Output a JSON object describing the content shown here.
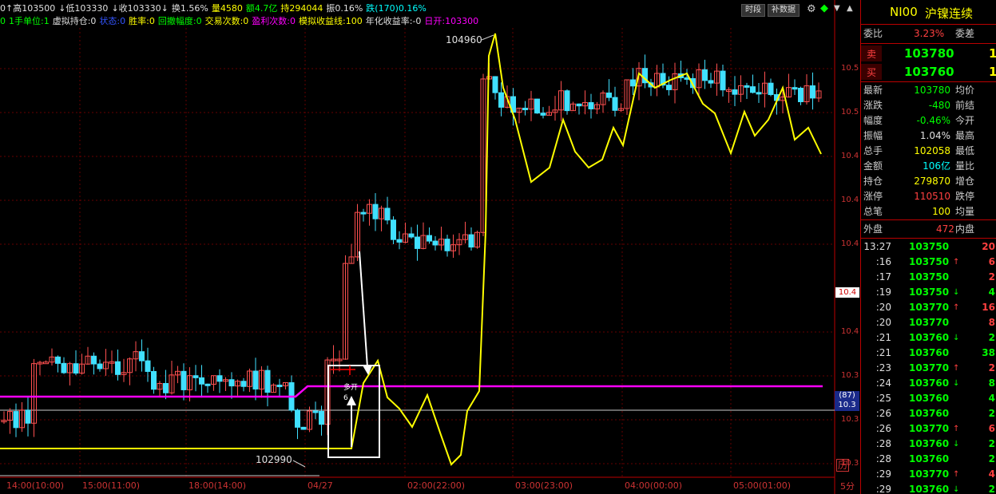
{
  "header": {
    "line1": [
      {
        "text": "0↑高103500",
        "color": "#e0e0e0"
      },
      {
        "text": "↓低103330",
        "color": "#e0e0e0"
      },
      {
        "text": "↓收103330↓",
        "color": "#e0e0e0"
      },
      {
        "text": "换1.56%",
        "color": "#e0e0e0"
      },
      {
        "text": "量4580",
        "color": "#ffff00"
      },
      {
        "text": "额4.7亿",
        "color": "#00ff00"
      },
      {
        "text": "持294044",
        "color": "#ffff00"
      },
      {
        "text": "振0.16%",
        "color": "#e0e0e0"
      },
      {
        "text": "跌(170)0.16%",
        "color": "#00ffff"
      }
    ],
    "line2": [
      {
        "text": "0",
        "color": "#00ff00"
      },
      {
        "text": "1手单位:1",
        "color": "#00ff00"
      },
      {
        "text": "虚拟持仓:0",
        "color": "#e0e0e0"
      },
      {
        "text": "状态:0",
        "color": "#3355ff"
      },
      {
        "text": "胜率:0",
        "color": "#ffff00"
      },
      {
        "text": "回撤幅度:0",
        "color": "#00ff00"
      },
      {
        "text": "交易次数:0",
        "color": "#ffff00"
      },
      {
        "text": "盈利次数:0",
        "color": "#ff00ff"
      },
      {
        "text": "模拟收益线:100",
        "color": "#ffff00"
      },
      {
        "text": "年化收益率:-0",
        "color": "#e0e0e0"
      },
      {
        "text": "日开:103300",
        "color": "#ff00ff"
      }
    ]
  },
  "top_buttons": {
    "timeshare": "时段",
    "refill": "补数据"
  },
  "annotations": {
    "high": "104960",
    "low": "102990",
    "open_long": "多开",
    "arrow_num": "6"
  },
  "x_axis": [
    "14:00(10:00)",
    "15:00(11:00)",
    "18:00(14:00)",
    "04/27",
    "02:00(22:00)",
    "03:00(23:00)",
    "04:00(00:00)",
    "05:00(01:00)"
  ],
  "y_axis": {
    "labels": [
      "10.5",
      "10.5",
      "10.4",
      "10.4",
      "10.4",
      "10.4",
      "10.3",
      "10.3",
      "10.3"
    ],
    "current": "10.4",
    "badge_top": "(87)",
    "badge_bottom": "10.3",
    "period": "5分",
    "corner_icon": "历"
  },
  "quote": {
    "title_code": "NI00",
    "title_name": "沪镍连续",
    "weibi_label": "委比",
    "weibi_value": "3.23%",
    "weicha_label": "委差",
    "sell_label": "卖",
    "sell_price": "103780",
    "buy_label": "买",
    "buy_price": "103760",
    "stats": [
      {
        "l1": "最新",
        "v1": "103780",
        "c1": "#00ff00",
        "l2": "均价"
      },
      {
        "l1": "涨跌",
        "v1": "-480",
        "c1": "#00ff00",
        "l2": "前结"
      },
      {
        "l1": "幅度",
        "v1": "-0.46%",
        "c1": "#00ff00",
        "l2": "今开"
      },
      {
        "l1": "振幅",
        "v1": "1.04%",
        "c1": "#e0e0e0",
        "l2": "最高"
      },
      {
        "l1": "总手",
        "v1": "102058",
        "c1": "#ffff00",
        "l2": "最低"
      },
      {
        "l1": "金额",
        "v1": "106亿",
        "c1": "#00ffff",
        "l2": "量比"
      },
      {
        "l1": "持仓",
        "v1": "279870",
        "c1": "#ffff00",
        "l2": "增仓"
      },
      {
        "l1": "涨停",
        "v1": "110510",
        "c1": "#ff4040",
        "l2": "跌停"
      },
      {
        "l1": "总笔",
        "v1": "100",
        "c1": "#ffff00",
        "l2": "均量"
      }
    ],
    "outer_label": "外盘",
    "outer_value": "472",
    "inner_label": "内盘",
    "ticks": [
      {
        "t": "13:27",
        "p": "103750",
        "a": "",
        "v": "20",
        "vc": "#ff4040"
      },
      {
        "t": ":16",
        "p": "103750",
        "a": "↑",
        "v": "6",
        "vc": "#ff4040"
      },
      {
        "t": ":17",
        "p": "103750",
        "a": "",
        "v": "2",
        "vc": "#ff4040"
      },
      {
        "t": ":19",
        "p": "103750",
        "a": "↓",
        "v": "4",
        "vc": "#00ff00"
      },
      {
        "t": ":20",
        "p": "103770",
        "a": "↑",
        "v": "16",
        "vc": "#ff4040"
      },
      {
        "t": ":20",
        "p": "103770",
        "a": "",
        "v": "8",
        "vc": "#ff4040"
      },
      {
        "t": ":21",
        "p": "103760",
        "a": "↓",
        "v": "2",
        "vc": "#00ff00"
      },
      {
        "t": ":21",
        "p": "103760",
        "a": "",
        "v": "38",
        "vc": "#00ff00"
      },
      {
        "t": ":23",
        "p": "103770",
        "a": "↑",
        "v": "2",
        "vc": "#ff4040"
      },
      {
        "t": ":24",
        "p": "103760",
        "a": "↓",
        "v": "8",
        "vc": "#00ff00"
      },
      {
        "t": ":25",
        "p": "103760",
        "a": "",
        "v": "4",
        "vc": "#00ff00"
      },
      {
        "t": ":26",
        "p": "103760",
        "a": "",
        "v": "2",
        "vc": "#00ff00"
      },
      {
        "t": ":26",
        "p": "103770",
        "a": "↑",
        "v": "6",
        "vc": "#ff4040"
      },
      {
        "t": ":28",
        "p": "103760",
        "a": "↓",
        "v": "2",
        "vc": "#00ff00"
      },
      {
        "t": ":28",
        "p": "103760",
        "a": "",
        "v": "2",
        "vc": "#00ff00"
      },
      {
        "t": ":29",
        "p": "103770",
        "a": "↑",
        "v": "4",
        "vc": "#ff4040"
      },
      {
        "t": ":29",
        "p": "103760",
        "a": "↓",
        "v": "2",
        "vc": "#00ff00"
      }
    ]
  },
  "colors": {
    "up": "#ff5050",
    "down": "#40e0ff",
    "yellow_line": "#ffff00",
    "magenta_line": "#ff00ff",
    "panel_border": "#b00000"
  }
}
